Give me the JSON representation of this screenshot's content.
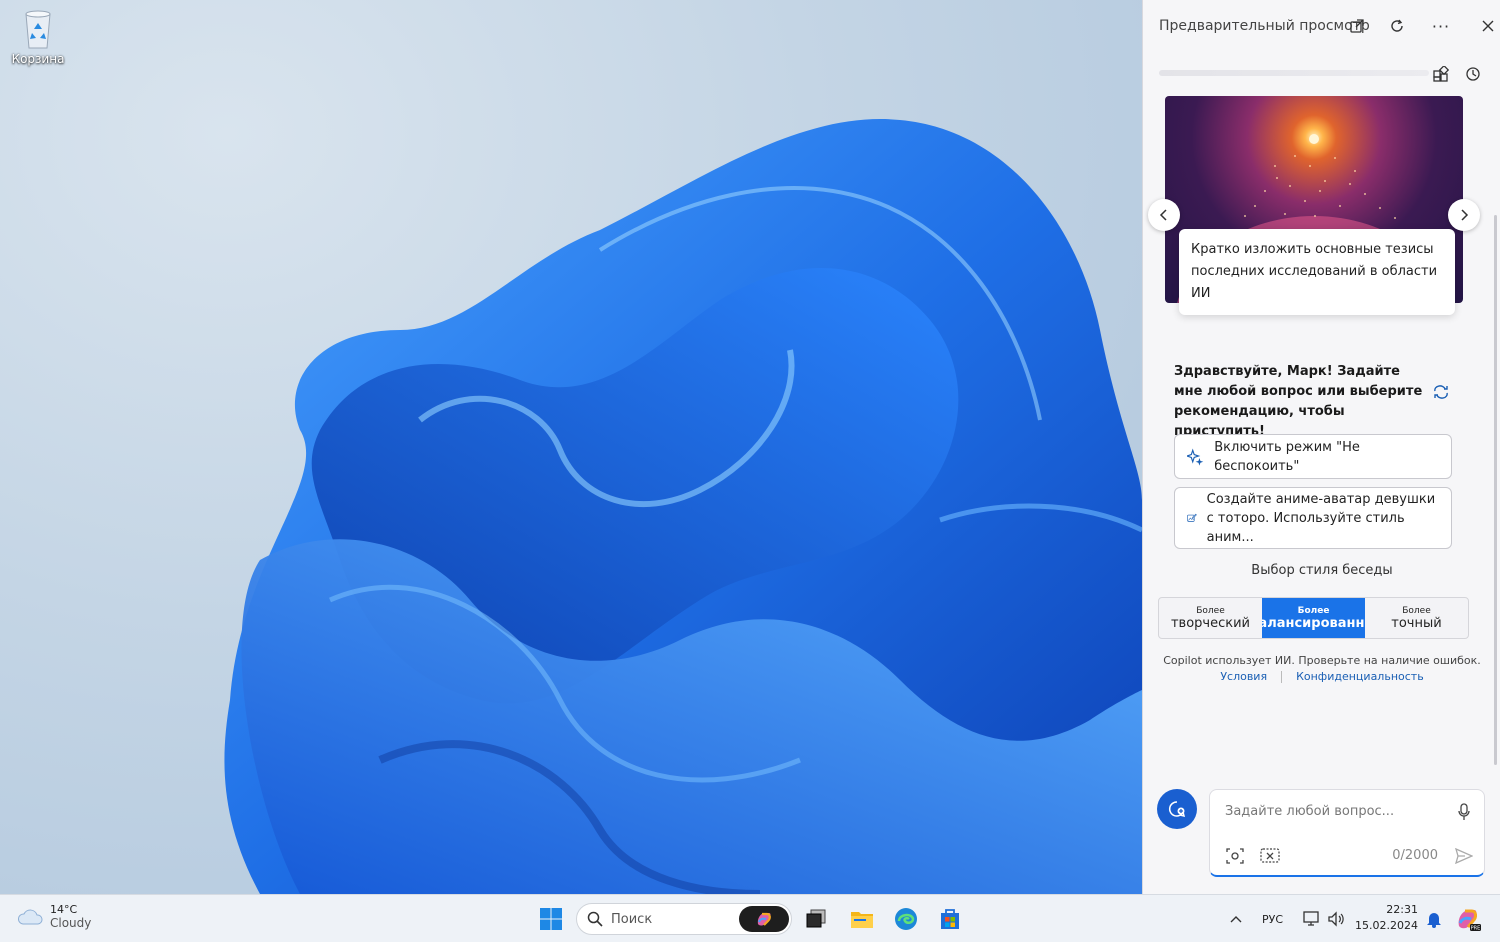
{
  "desktop": {
    "recycle_bin_label": "Корзина"
  },
  "copilot": {
    "title": "Предварительный просмотр",
    "card_prompt": "Кратко изложить основные тезисы последних исследований в области ИИ",
    "greeting": "Здравствуйте, Марк! Задайте мне любой вопрос или выберите рекомендацию, чтобы приступить!",
    "suggestions": [
      {
        "label": "Включить режим \"Не беспокоить\"",
        "icon": "sparkle-icon"
      },
      {
        "label": "Создайте аниме-аватар девушки с тоторо. Используйте стиль аним...",
        "icon": "image-edit-icon"
      }
    ],
    "style_title": "Выбор стиля беседы",
    "styles": [
      {
        "small": "Более",
        "big": "творческий",
        "active": false
      },
      {
        "small": "Более",
        "big": "сбалансированный",
        "active": true
      },
      {
        "small": "Более",
        "big": "точный",
        "active": false
      }
    ],
    "disclaimer": "Copilot использует ИИ. Проверьте на наличие ошибок.",
    "link_terms": "Условия",
    "link_privacy": "Конфиденциальность",
    "input_placeholder": "Задайте любой вопрос...",
    "counter": "0/2000",
    "accent_color": "#1a73e8"
  },
  "taskbar": {
    "weather_temp": "14°C",
    "weather_desc": "Cloudy",
    "search_label": "Поиск",
    "language": "РУС",
    "time": "22:31",
    "date": "15.02.2024"
  }
}
